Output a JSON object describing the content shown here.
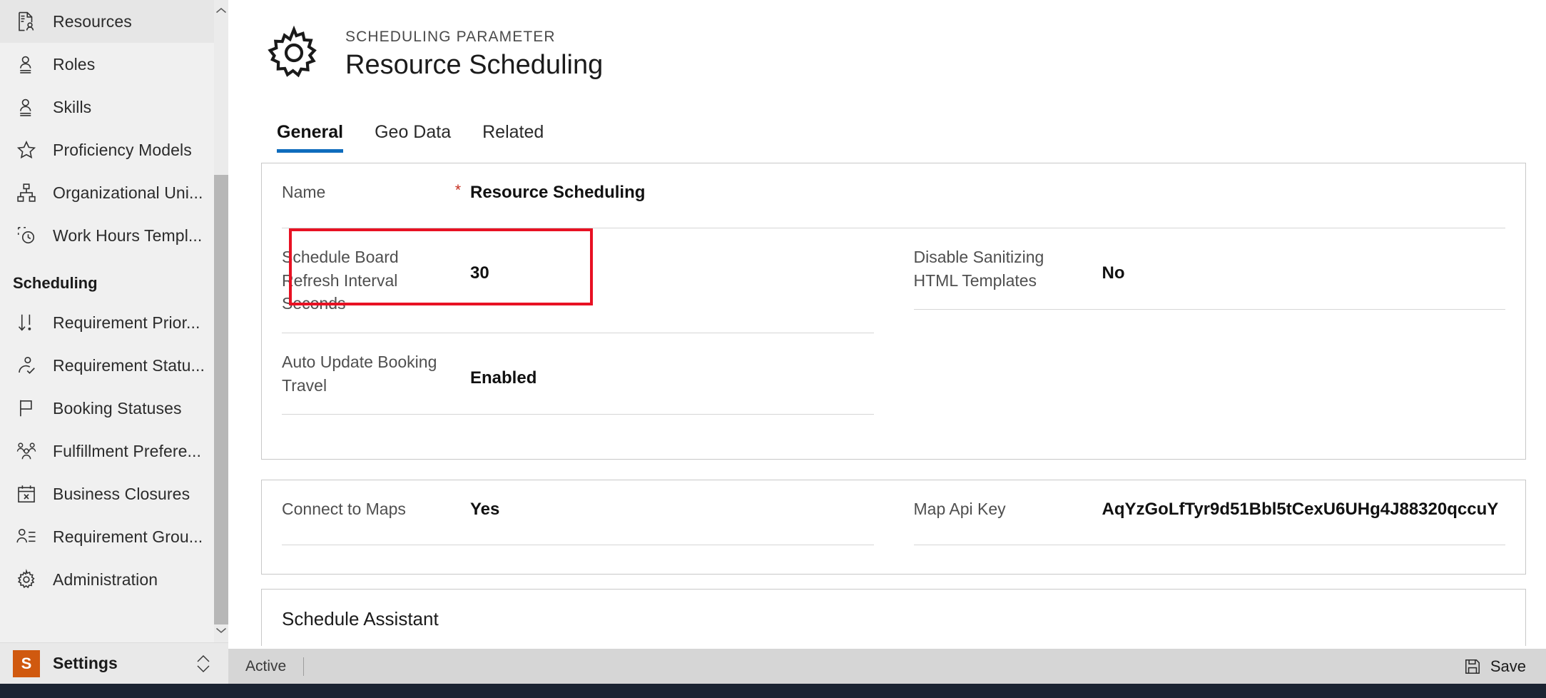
{
  "sidebar": {
    "items": [
      {
        "label": "Resources",
        "icon": "resources-document-person-icon"
      },
      {
        "label": "Roles",
        "icon": "person-role-icon"
      },
      {
        "label": "Skills",
        "icon": "person-skill-icon"
      },
      {
        "label": "Proficiency Models",
        "icon": "star-icon"
      },
      {
        "label": "Organizational Uni...",
        "icon": "org-hierarchy-icon"
      },
      {
        "label": "Work Hours Templ...",
        "icon": "work-hours-clock-icon"
      }
    ],
    "group_header": "Scheduling",
    "group_items": [
      {
        "label": "Requirement Prior...",
        "icon": "sort-priority-icon"
      },
      {
        "label": "Requirement Statu...",
        "icon": "person-check-icon"
      },
      {
        "label": "Booking Statuses",
        "icon": "flag-icon"
      },
      {
        "label": "Fulfillment Prefere...",
        "icon": "people-group-icon"
      },
      {
        "label": "Business Closures",
        "icon": "calendar-x-icon"
      },
      {
        "label": "Requirement Grou...",
        "icon": "person-list-icon"
      },
      {
        "label": "Administration",
        "icon": "gear-icon"
      }
    ],
    "scrollbar": {
      "up_arrow": "⌃",
      "down_arrow": "⌄"
    },
    "footer": {
      "badge_letter": "S",
      "label": "Settings",
      "expander_icon": "chevron-up-down-icon"
    }
  },
  "header": {
    "record_icon": "gear-icon",
    "entity_name": "SCHEDULING PARAMETER",
    "record_title": "Resource Scheduling"
  },
  "tabs": [
    {
      "label": "General",
      "active": true
    },
    {
      "label": "Geo Data",
      "active": false
    },
    {
      "label": "Related",
      "active": false
    }
  ],
  "form": {
    "name_field": {
      "label": "Name",
      "required_marker": "*",
      "value": "Resource Scheduling"
    },
    "refresh_interval_field": {
      "label": "Schedule Board Refresh Interval Seconds",
      "value": "30"
    },
    "disable_sanitizing_field": {
      "label": "Disable Sanitizing HTML Templates",
      "value": "No"
    },
    "auto_update_travel_field": {
      "label": "Auto Update Booking Travel",
      "value": "Enabled",
      "highlighted": true,
      "highlight_color": "#e81123"
    },
    "connect_to_maps_field": {
      "label": "Connect to Maps",
      "value": "Yes"
    },
    "map_api_key_field": {
      "label": "Map Api Key",
      "value": "AqYzGoLfTyr9d51Bbl5tCexU6UHg4J88320qccuY"
    },
    "assistant_section": {
      "title": "Schedule Assistant"
    }
  },
  "statusbar": {
    "status": "Active",
    "save_icon": "save-floppy-icon",
    "save_label": "Save"
  },
  "colors": {
    "accent": "#0f6cbd",
    "highlight": "#e81123",
    "required": "#c42b1c",
    "settings_badge": "#d0590f",
    "sidebar_bg": "#f0f0f0",
    "statusbar_bg": "#d6d6d6"
  }
}
